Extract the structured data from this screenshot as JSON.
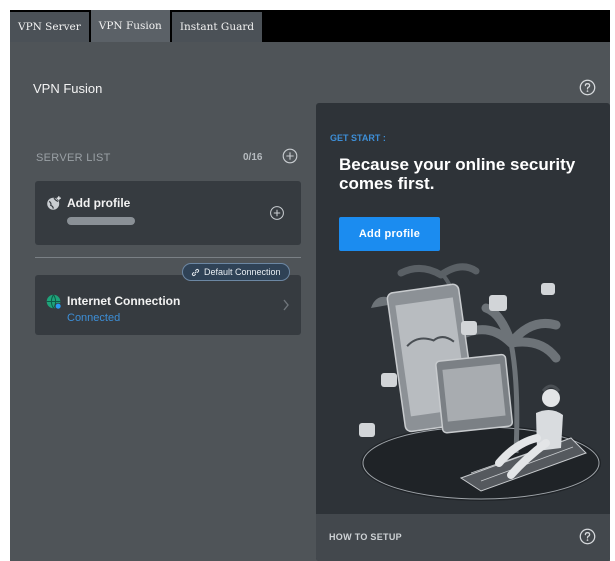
{
  "tabs": [
    {
      "label": "VPN Server"
    },
    {
      "label": "VPN Fusion"
    },
    {
      "label": "Instant Guard"
    }
  ],
  "page": {
    "title": "VPN Fusion"
  },
  "server_list": {
    "label": "SERVER LIST",
    "count": "0/16"
  },
  "add_profile_card": {
    "title": "Add profile"
  },
  "default_connection_badge": {
    "label": "Default Connection"
  },
  "internet_card": {
    "title": "Internet Connection",
    "status": "Connected"
  },
  "promo": {
    "get_start": "GET START :",
    "headline": "Because your online security comes first.",
    "button_label": "Add profile",
    "how_to_setup": "HOW TO SETUP"
  },
  "colors": {
    "accent": "#1b8cf0",
    "status_connected": "#3d8ed6",
    "panel_bg": "#4f5458",
    "card_bg": "#363b40"
  },
  "icons": [
    "help-icon",
    "add-circle-icon",
    "globe-icon",
    "link-icon",
    "chevron-right-icon"
  ]
}
